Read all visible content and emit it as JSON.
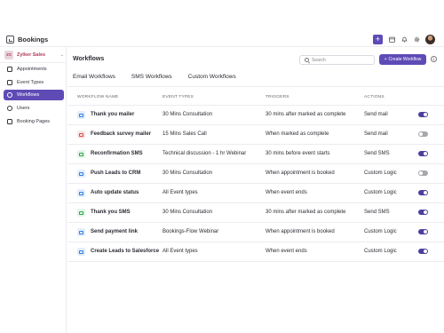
{
  "app": {
    "name": "Bookings"
  },
  "org": {
    "badge": "ZS",
    "name": "Zylker Sales"
  },
  "sidebar": {
    "items": [
      {
        "label": "Appointments",
        "active": false
      },
      {
        "label": "Event Types",
        "active": false
      },
      {
        "label": "Workflows",
        "active": true
      },
      {
        "label": "Users",
        "active": false
      },
      {
        "label": "Booking Pages",
        "active": false
      }
    ]
  },
  "page": {
    "title": "Workflows",
    "search_placeholder": "Search",
    "create_label": "Create Workflow",
    "create_plus": "+"
  },
  "tabs": [
    "Email Workflows",
    "SMS Workflows",
    "Custom Workflows"
  ],
  "table": {
    "headers": [
      "WORKFLOW NAME",
      "EVENT TYPES",
      "TRIGGERS",
      "ACTIONS"
    ],
    "rows": [
      {
        "name": "Thank you mailer",
        "event": "30 Mins Consultation",
        "trigger": "30 mins after marked as complete",
        "action": "Send mail",
        "enabled": true,
        "icon": "mail-icon",
        "icon_color": "blue"
      },
      {
        "name": "Feedback survey mailer",
        "event": "15 Mins Sales Call",
        "trigger": "When marked as complete",
        "action": "Send mail",
        "enabled": false,
        "icon": "mail-icon",
        "icon_color": "red"
      },
      {
        "name": "Reconfirmation SMS",
        "event": "Technical discussion - 1 hr Webinar",
        "trigger": "30 mins before event starts",
        "action": "Send SMS",
        "enabled": true,
        "icon": "sms-icon",
        "icon_color": "green"
      },
      {
        "name": "Push Leads to CRM",
        "event": "30 Mins Consultation",
        "trigger": "When appointment is booked",
        "action": "Custom Logic",
        "enabled": false,
        "icon": "code-icon",
        "icon_color": "blue"
      },
      {
        "name": "Auto update status",
        "event": "All Event types",
        "trigger": "When event ends",
        "action": "Custom Logic",
        "enabled": true,
        "icon": "code-icon",
        "icon_color": "blue"
      },
      {
        "name": "Thank you SMS",
        "event": "30 Mins Consultation",
        "trigger": "30 mins after marked as complete",
        "action": "Send SMS",
        "enabled": true,
        "icon": "sms-icon",
        "icon_color": "green"
      },
      {
        "name": "Send payment link",
        "event": "Bookings-Flow Webinar",
        "trigger": "When appointment is booked",
        "action": "Custom Logic",
        "enabled": true,
        "icon": "code-icon",
        "icon_color": "blue"
      },
      {
        "name": "Create Leads to Salesforce",
        "event": "All Event types",
        "trigger": "When event ends",
        "action": "Custom Logic",
        "enabled": true,
        "icon": "code-icon",
        "icon_color": "blue"
      }
    ]
  },
  "colors": {
    "accent": "#5f4bb6",
    "toggle_on": "#4b3f9e",
    "toggle_off": "#a7a7ad"
  }
}
